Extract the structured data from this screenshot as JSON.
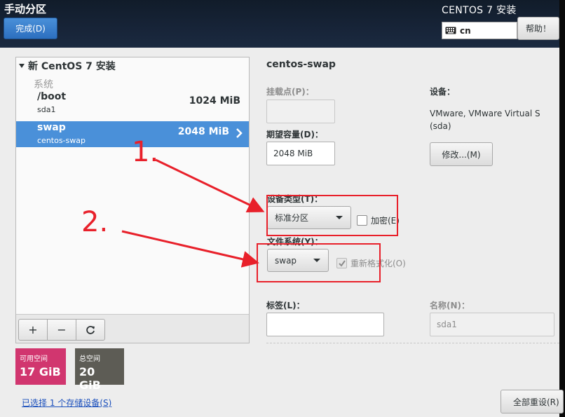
{
  "header": {
    "title": "手动分区",
    "done_label": "完成(D)",
    "product_title": "CENTOS 7 安装",
    "keyboard_layout": "cn",
    "help_label": "帮助！"
  },
  "tree": {
    "root_label": "新 CentOS 7 安装",
    "group_label": "系统",
    "partitions": [
      {
        "mount": "/boot",
        "device": "sda1",
        "size": "1024 MiB",
        "selected": false
      },
      {
        "mount": "swap",
        "device": "centos-swap",
        "size": "2048 MiB",
        "selected": true
      }
    ]
  },
  "toolbar": {
    "add_label": "+",
    "remove_label": "−",
    "refresh_icon": "refresh-icon"
  },
  "space": {
    "available_label": "可用空间",
    "available_value": "17 GiB",
    "total_label": "总空间",
    "total_value": "20 GiB"
  },
  "storage_link": "已选择 1 个存储设备(S)",
  "details": {
    "title": "centos-swap",
    "mount_point_label": "挂载点(P)：",
    "mount_point_value": "",
    "desired_capacity_label": "期望容量(D)：",
    "desired_capacity_value": "2048 MiB",
    "device_label": "设备：",
    "device_info_line1": "VMware, VMware Virtual S",
    "device_info_line2": "(sda)",
    "modify_label": "修改...(M)",
    "device_type_label": "设备类型(T)：",
    "device_type_value": "标准分区",
    "encrypt_label": "加密(E)",
    "encrypt_checked": false,
    "filesystem_label": "文件系统(Y)：",
    "filesystem_value": "swap",
    "reformat_label": "重新格式化(O)",
    "reformat_checked": true,
    "label_label": "标签(L)：",
    "label_value": "",
    "name_label": "名称(N)：",
    "name_value": "sda1",
    "reset_all_label": "全部重设(R)"
  },
  "annotations": {
    "step1": "1.",
    "step2": "2.",
    "color": "#e8202a"
  },
  "colors": {
    "selected_row": "#4a90d9",
    "available_space": "#d1366f",
    "total_space": "#5d5c55",
    "header_bg": "#172438"
  }
}
